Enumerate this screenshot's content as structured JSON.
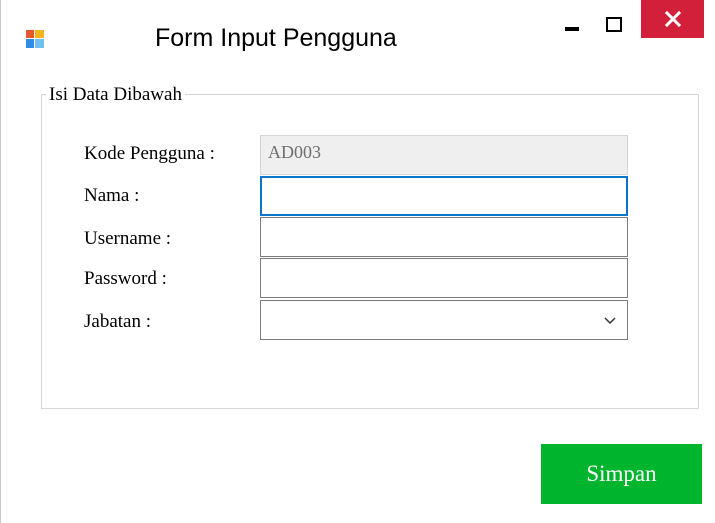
{
  "window": {
    "title": "Form Input Pengguna",
    "controls": {
      "minimize_icon": "minimize-icon",
      "maximize_icon": "maximize-icon",
      "close_icon": "close-icon"
    }
  },
  "group": {
    "legend": "Isi Data Dibawah"
  },
  "fields": {
    "kode_pengguna": {
      "label": "Kode Pengguna :",
      "value": "AD003"
    },
    "nama": {
      "label": "Nama :",
      "value": ""
    },
    "username": {
      "label": "Username :",
      "value": ""
    },
    "password": {
      "label": "Password :",
      "value": ""
    },
    "jabatan": {
      "label": "Jabatan :",
      "selected": ""
    }
  },
  "actions": {
    "save_label": "Simpan"
  },
  "colors": {
    "close_button": "#d21f3a",
    "save_button": "#00b52e",
    "focus_border": "#0a76c9"
  }
}
